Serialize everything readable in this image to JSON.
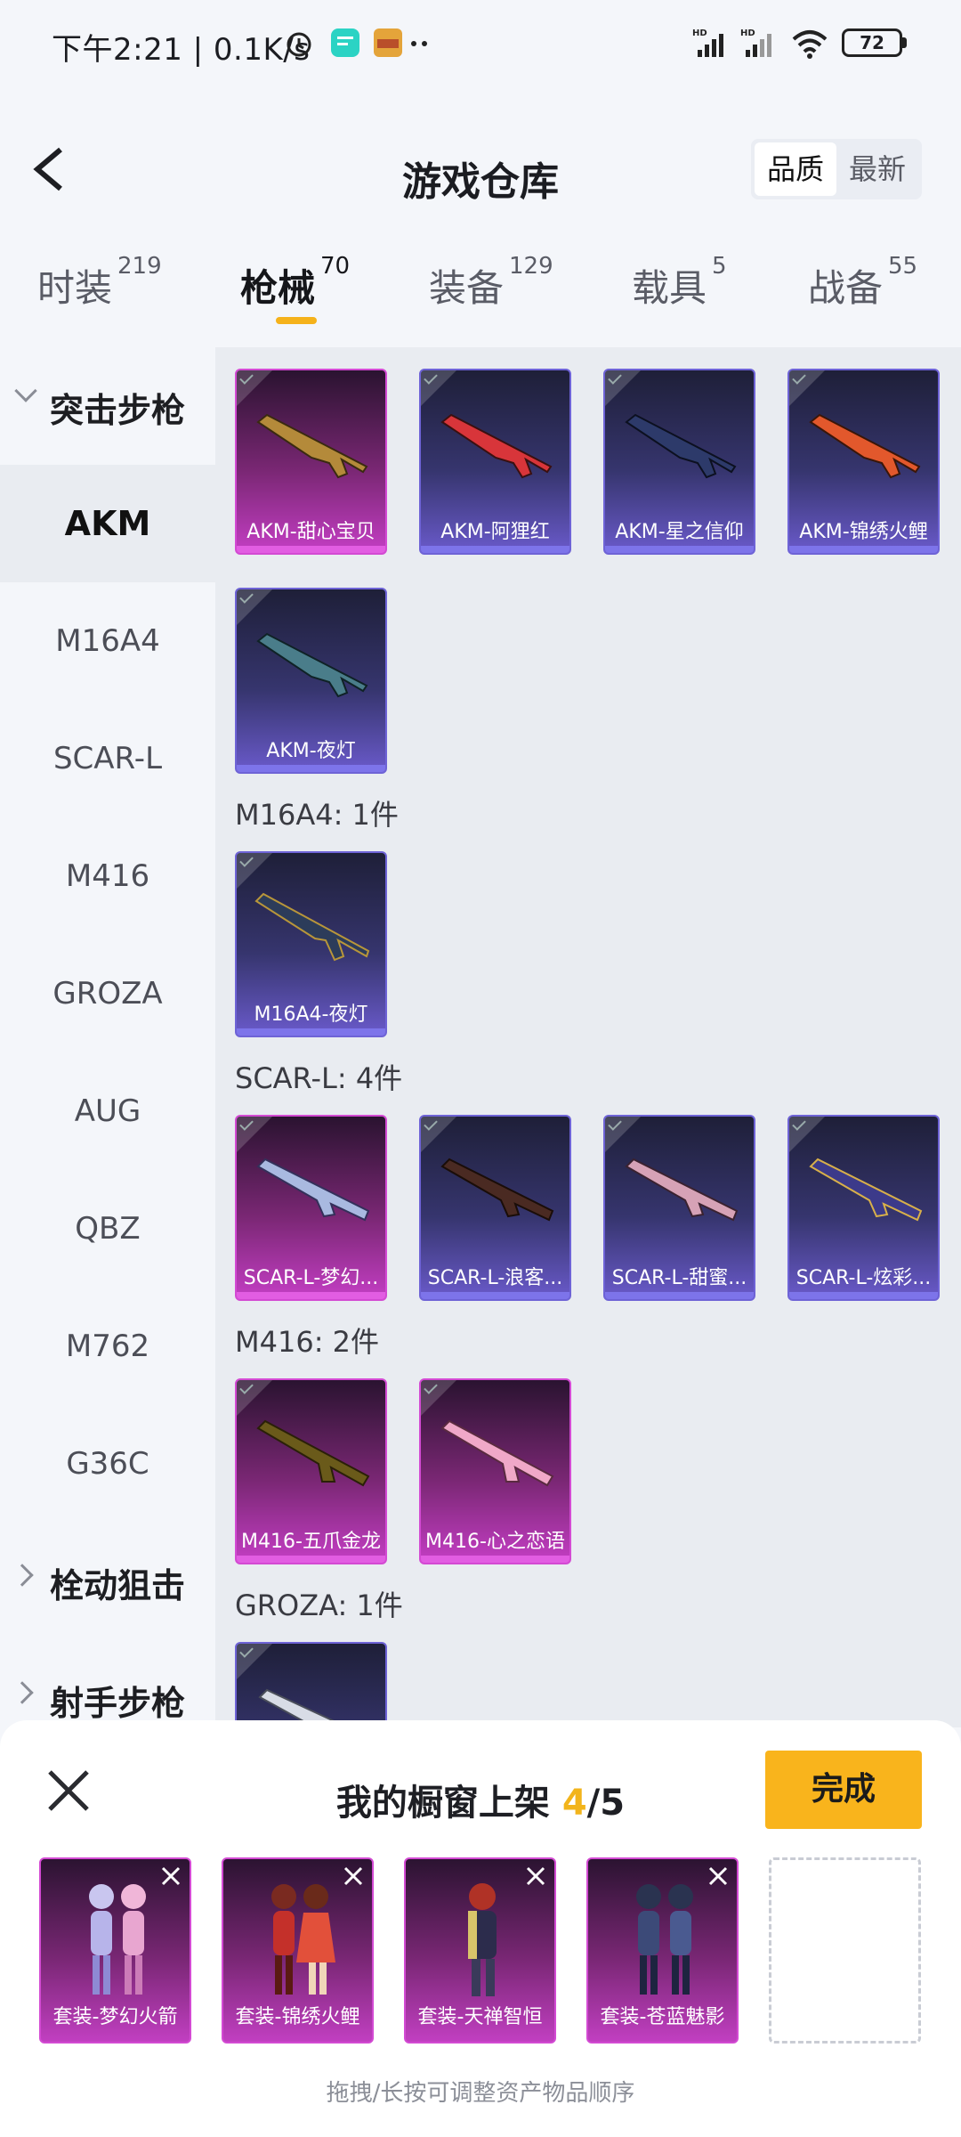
{
  "status_bar": {
    "time": "下午2:21 | 0.1K/s",
    "battery": "72"
  },
  "header": {
    "title": "游戏仓库",
    "sort_options": [
      "品质",
      "最新"
    ]
  },
  "tabs": [
    {
      "label": "时装",
      "count": "219"
    },
    {
      "label": "枪械",
      "count": "70"
    },
    {
      "label": "装备",
      "count": "129"
    },
    {
      "label": "载具",
      "count": "5"
    },
    {
      "label": "战备",
      "count": "55"
    }
  ],
  "leftnav": {
    "cat1": "突击步枪",
    "items": [
      "AKM",
      "M16A4",
      "SCAR-L",
      "M416",
      "GROZA",
      "AUG",
      "QBZ",
      "M762",
      "G36C"
    ],
    "cat2": "栓动狙击",
    "cat3": "射手步枪"
  },
  "sections": {
    "akm": {
      "cards": [
        "AKM-甜心宝贝",
        "AKM-阿狸红",
        "AKM-星之信仰",
        "AKM-锦绣火鲤",
        "AKM-夜灯"
      ]
    },
    "m16a4": {
      "heading": "M16A4: 1件",
      "cards": [
        "M16A4-夜灯"
      ]
    },
    "scar": {
      "heading": "SCAR-L: 4件",
      "cards": [
        "SCAR-L-梦幻...",
        "SCAR-L-浪客...",
        "SCAR-L-甜蜜...",
        "SCAR-L-炫彩..."
      ]
    },
    "m416": {
      "heading": "M416: 2件",
      "cards": [
        "M416-五爪金龙",
        "M416-心之恋语"
      ]
    },
    "groza": {
      "heading": "GROZA: 1件"
    }
  },
  "panel": {
    "title_prefix": "我的橱窗上架 ",
    "count": "4",
    "total": "/5",
    "done": "完成",
    "slots": [
      "套装-梦幻火箭",
      "套装-锦绣火鲤",
      "套装-天禅智恒",
      "套装-苍蓝魅影"
    ],
    "hint": "拖拽/长按可调整资产物品顺序"
  },
  "colors": {
    "accent": "#f9b41c",
    "purple_card": "#6e63d6",
    "pink_card": "#d34ad3"
  }
}
